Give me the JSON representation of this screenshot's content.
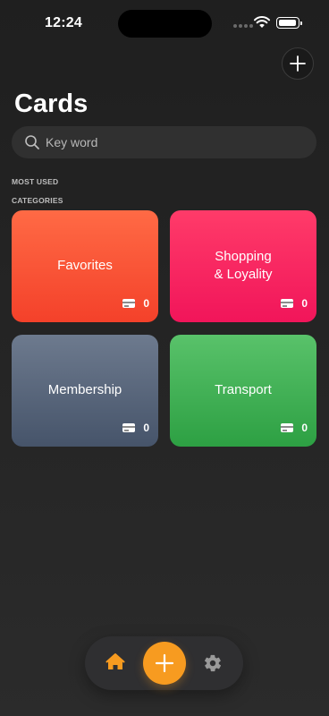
{
  "status_bar": {
    "time": "12:24"
  },
  "header": {
    "title": "Cards"
  },
  "search": {
    "placeholder": "Key word"
  },
  "sections": {
    "most_used": "MOST USED",
    "categories": "CATEGORIES"
  },
  "categories": [
    {
      "title": "Favorites",
      "count": "0",
      "color": "#f4532f"
    },
    {
      "title": "Shopping\n& Loyality",
      "count": "0",
      "color": "#f62560"
    },
    {
      "title": "Membership",
      "count": "0",
      "color": "#5a677c"
    },
    {
      "title": "Transport",
      "count": "0",
      "color": "#3eb052"
    }
  ],
  "tab_bar": {
    "icons": [
      "home-icon",
      "plus-icon",
      "gear-icon"
    ],
    "accent": "#f79b20"
  }
}
